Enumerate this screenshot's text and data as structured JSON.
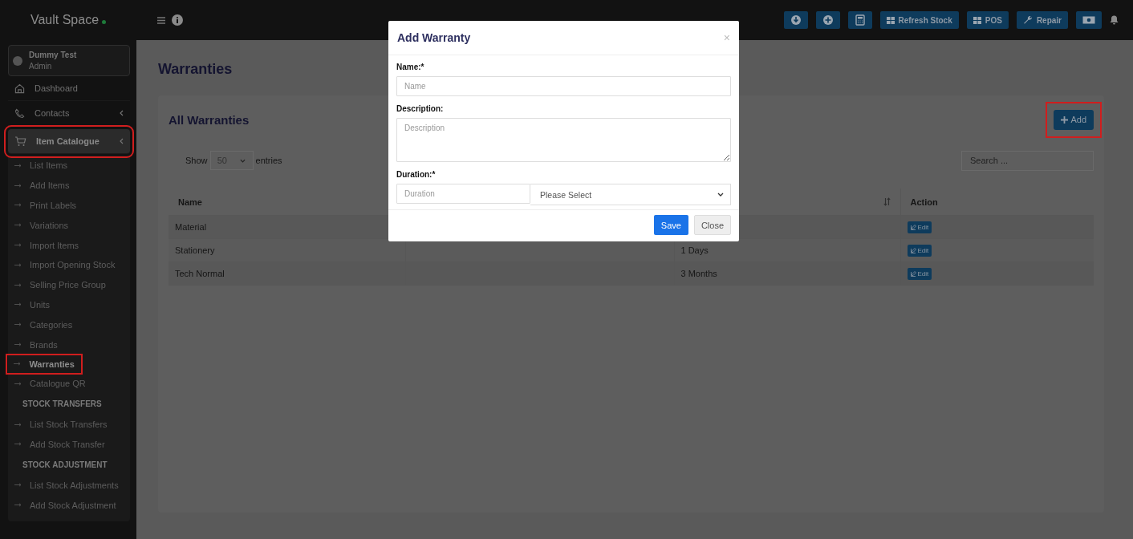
{
  "brand": {
    "name": "Vault Space",
    "online": true
  },
  "toolbar": [
    {
      "kind": "icon"
    },
    {
      "kind": "icon"
    },
    {
      "kind": "icon"
    },
    {
      "kind": "text",
      "label": "Refresh Stock"
    },
    {
      "kind": "text",
      "label": "POS"
    },
    {
      "kind": "text",
      "label": "Repair"
    },
    {
      "kind": "icon"
    }
  ],
  "user": {
    "name": "Dummy Test",
    "role": "Admin"
  },
  "sidebar": {
    "items": [
      {
        "label": "Dashboard",
        "kind": "link",
        "selected": false,
        "highlighted": false
      },
      {
        "label": "Contacts",
        "kind": "group",
        "selected": false,
        "highlighted": false
      },
      {
        "label": "Item Catalogue",
        "kind": "group",
        "selected": true,
        "highlighted": true
      }
    ],
    "sub_items": [
      {
        "kind": "link",
        "label": "List Items",
        "selected": false,
        "highlighted": false
      },
      {
        "kind": "link",
        "label": "Add Items",
        "selected": false,
        "highlighted": false
      },
      {
        "kind": "link",
        "label": "Print Labels",
        "selected": false,
        "highlighted": false
      },
      {
        "kind": "link",
        "label": "Variations",
        "selected": false,
        "highlighted": false
      },
      {
        "kind": "link",
        "label": "Import Items",
        "selected": false,
        "highlighted": false
      },
      {
        "kind": "link",
        "label": "Import Opening Stock",
        "selected": false,
        "highlighted": false
      },
      {
        "kind": "link",
        "label": "Selling Price Group",
        "selected": false,
        "highlighted": false
      },
      {
        "kind": "link",
        "label": "Units",
        "selected": false,
        "highlighted": false
      },
      {
        "kind": "link",
        "label": "Categories",
        "selected": false,
        "highlighted": false
      },
      {
        "kind": "link",
        "label": "Brands",
        "selected": false,
        "highlighted": false
      },
      {
        "kind": "link",
        "label": "Warranties",
        "selected": true,
        "highlighted": true
      },
      {
        "kind": "link",
        "label": "Catalogue QR",
        "selected": false,
        "highlighted": false
      },
      {
        "kind": "header",
        "label": "STOCK TRANSFERS"
      },
      {
        "kind": "link",
        "label": "List Stock Transfers",
        "selected": false,
        "highlighted": false
      },
      {
        "kind": "link",
        "label": "Add Stock Transfer",
        "selected": false,
        "highlighted": false
      },
      {
        "kind": "header",
        "label": "STOCK ADJUSTMENT"
      },
      {
        "kind": "link",
        "label": "List Stock Adjustments",
        "selected": false,
        "highlighted": false
      },
      {
        "kind": "link",
        "label": "Add Stock Adjustment",
        "selected": false,
        "highlighted": false
      }
    ]
  },
  "page": {
    "title": "Warranties",
    "card_title": "All Warranties",
    "add_button": {
      "label": "Add",
      "highlighted": true
    },
    "show_label": "Show",
    "page_size": "50",
    "entries_label": "entries",
    "search": {
      "placeholder": "Search ..."
    }
  },
  "table": {
    "columns": [
      "Name",
      "",
      "",
      "Action"
    ],
    "rows": [
      {
        "name": "Material",
        "description": "",
        "duration": "",
        "action": "Edit"
      },
      {
        "name": "Stationery",
        "description": "",
        "duration": "1 Days",
        "action": "Edit"
      },
      {
        "name": "Tech Normal",
        "description": "",
        "duration": "3 Months",
        "action": "Edit"
      }
    ]
  },
  "modal": {
    "title": "Add Warranty",
    "close": "×",
    "fields": [
      {
        "kind": "input",
        "label": "Name:*",
        "placeholder": "Name"
      },
      {
        "kind": "textarea",
        "label": "Description:",
        "placeholder": "Description"
      },
      {
        "kind": "duration",
        "label": "Duration:*",
        "placeholder": "Duration",
        "select": "Please Select"
      }
    ],
    "buttons": [
      {
        "kind": "primary",
        "label": "Save"
      },
      {
        "kind": "secondary",
        "label": "Close"
      }
    ]
  }
}
